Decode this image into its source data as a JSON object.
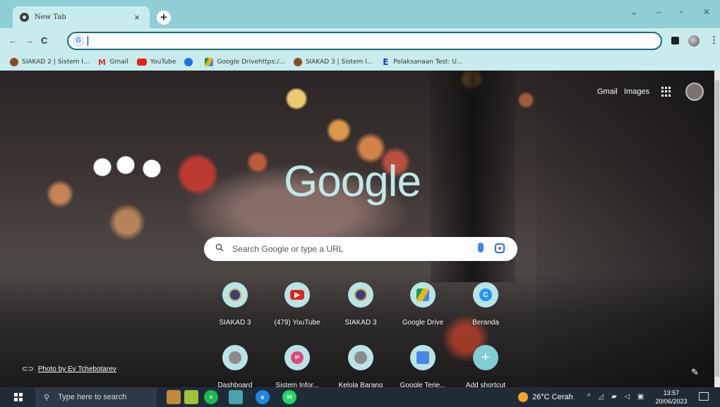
{
  "browser": {
    "tab_title": "New Tab",
    "tab_close": "×",
    "new_tab": "+",
    "window_controls": {
      "chevron": "⌄",
      "minimize": "–",
      "maximize": "▫",
      "close": "✕"
    }
  },
  "toolbar": {
    "omnibox_value": "",
    "back_icon": "←",
    "forward_icon": "→",
    "reload_icon": "C",
    "menu_icon": "⋮"
  },
  "bookmarks": [
    {
      "label": "SIAKAD 2 | Sistem I...",
      "icon": "siakad-icon"
    },
    {
      "label": "Gmail",
      "icon": "gmail-icon"
    },
    {
      "label": "YouTube",
      "icon": "youtube-icon"
    },
    {
      "label": "",
      "icon": "google-icon"
    },
    {
      "label": "Google Drivehttps:/...",
      "icon": "drive-icon"
    },
    {
      "label": "SIAKAD 3 | Sistem I...",
      "icon": "siakad-icon"
    },
    {
      "label": "Pelaksanaan Test: U...",
      "icon": "te-icon"
    }
  ],
  "ntp": {
    "gmail": "Gmail",
    "images": "Images",
    "logo": "Google",
    "search_placeholder": "Search Google or type a URL",
    "shortcuts_row1": [
      {
        "label": "SIAKAD 3",
        "icon": "siakad-icon"
      },
      {
        "label": "(479) YouTube",
        "icon": "youtube-icon"
      },
      {
        "label": "SIAKAD 3",
        "icon": "siakad-icon"
      },
      {
        "label": "Google Drive",
        "icon": "drive-icon"
      },
      {
        "label": "Beranda",
        "icon": "beranda-icon"
      }
    ],
    "shortcuts_row2": [
      {
        "label": "Dashboard",
        "icon": "dashboard-icon"
      },
      {
        "label": "Sistem Infor...",
        "icon": "sistem-icon",
        "glyph": "IP"
      },
      {
        "label": "Kelola Barang",
        "icon": "kelola-icon"
      },
      {
        "label": "Google Terje...",
        "icon": "translate-icon"
      },
      {
        "label": "Add shortcut",
        "icon": "add-icon",
        "glyph": "+"
      }
    ],
    "photo_credit": "Photo by Ev Tchebotarev"
  },
  "taskbar": {
    "search_placeholder": "Type here to search",
    "whatsapp_badge": "50",
    "weather": "26°C  Cerah",
    "time": "13:57",
    "date": "20/06/2023"
  }
}
